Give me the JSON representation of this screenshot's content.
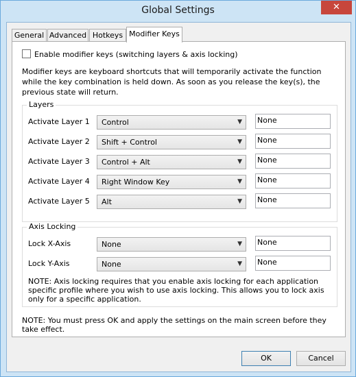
{
  "window": {
    "title": "Global Settings",
    "close_glyph": "✕"
  },
  "tabs": [
    {
      "label": "General"
    },
    {
      "label": "Advanced"
    },
    {
      "label": "Hotkeys"
    },
    {
      "label": "Modifier Keys",
      "active": true
    }
  ],
  "enable_modifier": {
    "label": "Enable modifier keys (switching layers & axis locking)",
    "checked": false
  },
  "description": "Modifier keys are keyboard shortcuts that will temporarily activate the function while the key combination is held down. As soon as you release the key(s), the previous state will return.",
  "layers": {
    "title": "Layers",
    "rows": [
      {
        "label": "Activate Layer 1",
        "modifier": "Control",
        "key": "None"
      },
      {
        "label": "Activate Layer 2",
        "modifier": "Shift + Control",
        "key": "None"
      },
      {
        "label": "Activate Layer 3",
        "modifier": "Control + Alt",
        "key": "None"
      },
      {
        "label": "Activate Layer 4",
        "modifier": "Right Window Key",
        "key": "None"
      },
      {
        "label": "Activate Layer 5",
        "modifier": "Alt",
        "key": "None"
      }
    ]
  },
  "axis_locking": {
    "title": "Axis Locking",
    "rows": [
      {
        "label": "Lock X-Axis",
        "modifier": "None",
        "key": "None"
      },
      {
        "label": "Lock Y-Axis",
        "modifier": "None",
        "key": "None"
      }
    ],
    "note": "NOTE: Axis locking requires that you enable axis locking for each application specific profile where you wish to use axis locking. This allows you to lock axis only for a specific application."
  },
  "bottom_note": "NOTE: You must press OK and apply the settings on the main screen before they take effect.",
  "buttons": {
    "ok": "OK",
    "cancel": "Cancel"
  },
  "icons": {
    "dropdown": "chevron-down-icon"
  },
  "colors": {
    "title_bar": "#cde4f5",
    "close": "#c7463c",
    "panel": "#ffffff"
  }
}
